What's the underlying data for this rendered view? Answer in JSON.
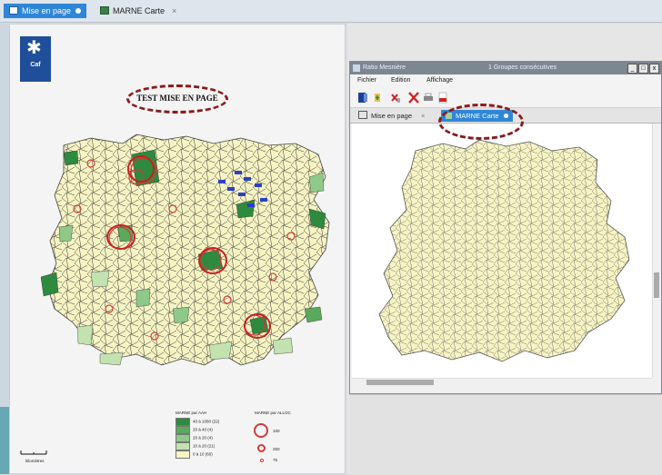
{
  "tabs": [
    {
      "label": "Mise en page",
      "active": true
    },
    {
      "label": "MARNE Carte",
      "active": false
    }
  ],
  "document": {
    "logo_text": "Caf",
    "title": "TEST MISE EN PAGE",
    "legend": {
      "title_left": "MARNE par AAH",
      "rows": [
        {
          "label": "40 à 1080  (22)",
          "color": "#2e8a3e"
        },
        {
          "label": "20 à   40   (4)",
          "color": "#5aaa5c"
        },
        {
          "label": "20 à   20   (4)",
          "color": "#8ec98a"
        },
        {
          "label": "10 à   20  (21)",
          "color": "#c2e2b0"
        },
        {
          "label": "0 à   10  (60)",
          "color": "#f7f4c4"
        }
      ],
      "title_right": "MARNE par ALLOC",
      "circle_labels": [
        "100",
        "250",
        "75"
      ]
    },
    "scale_label": "kilomètres"
  },
  "window": {
    "app_title": "Ratio Mesnière",
    "doc_title": "1 Groupes consécutives",
    "menus": [
      "Fichier",
      "Edition",
      "Affichage"
    ],
    "inner_tabs": [
      {
        "label": "Mise en page",
        "active": false
      },
      {
        "label": "MARNE Carte",
        "active": true
      }
    ],
    "controls": [
      "_",
      "□",
      "x"
    ]
  },
  "colors": {
    "accent": "#2f86d6",
    "map_fill": "#f7f4c4",
    "annotation": "#8b1a1a",
    "circle": "#d13a3a"
  }
}
